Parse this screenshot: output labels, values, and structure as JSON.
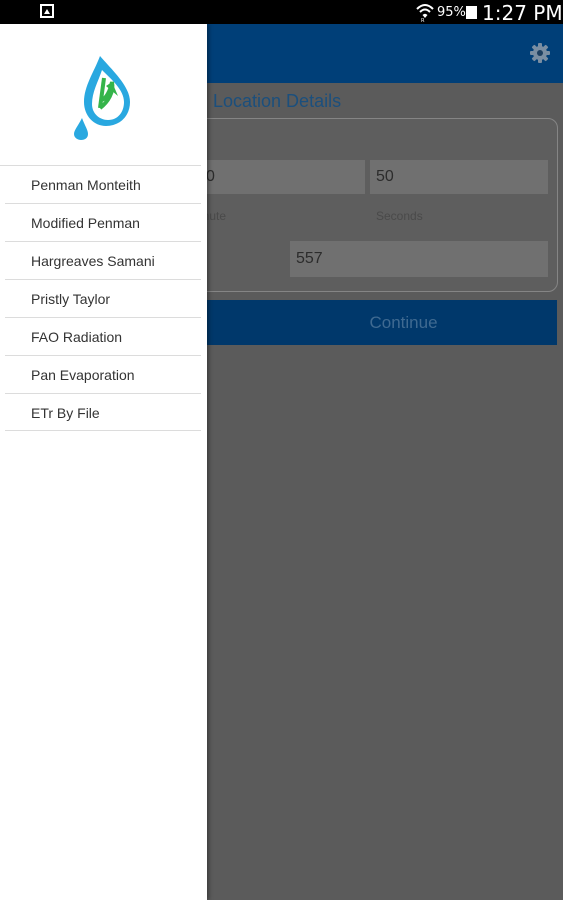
{
  "status_bar": {
    "battery_percent": "95%",
    "time": "1:27 PM",
    "icons": [
      "gallery-icon",
      "wifi-icon",
      "battery-icon"
    ]
  },
  "app": {
    "screen_title": "Location Details",
    "fields": {
      "minute_value": "0",
      "seconds_value": "50",
      "elevation_value": "557"
    },
    "captions": {
      "minute": "inute",
      "seconds": "Seconds"
    },
    "continue_label": "Continue",
    "colors": {
      "appbar": "#003f78",
      "button": "#00386b",
      "title": "#1b4f7d"
    }
  },
  "drawer": {
    "items": [
      {
        "label": "Penman Monteith"
      },
      {
        "label": "Modified Penman"
      },
      {
        "label": "Hargreaves Samani"
      },
      {
        "label": "Pristly Taylor"
      },
      {
        "label": "FAO Radiation"
      },
      {
        "label": "Pan Evaporation"
      },
      {
        "label": "ETr By File"
      }
    ]
  }
}
